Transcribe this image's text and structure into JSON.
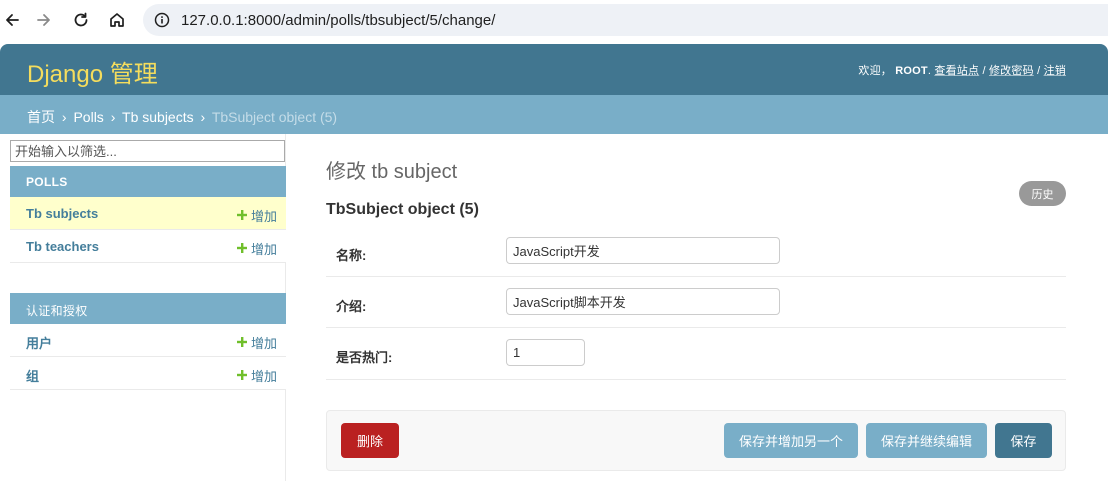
{
  "browser": {
    "url": "127.0.0.1:8000/admin/polls/tbsubject/5/change/"
  },
  "header": {
    "brand": "Django 管理",
    "welcome": "欢迎，",
    "username": "ROOT",
    "view_site": "查看站点",
    "separator": "/",
    "change_password": "修改密码",
    "logout": "注销"
  },
  "breadcrumbs": {
    "home": "首页",
    "app": "Polls",
    "model": "Tb subjects",
    "current": "TbSubject object (5)",
    "sep": "›"
  },
  "sidebar": {
    "filter_placeholder": "开始输入以筛选...",
    "modules": [
      {
        "caption": "POLLS",
        "models": [
          {
            "name": "Tb subjects",
            "add_label": "增加",
            "current": true
          },
          {
            "name": "Tb teachers",
            "add_label": "增加",
            "current": false
          }
        ]
      },
      {
        "caption": "认证和授权",
        "models": [
          {
            "name": "用户",
            "add_label": "增加",
            "current": false
          },
          {
            "name": "组",
            "add_label": "增加",
            "current": false
          }
        ]
      }
    ]
  },
  "content": {
    "title": "修改 tb subject",
    "history_label": "历史",
    "object_title": "TbSubject object (5)",
    "fields": [
      {
        "label": "名称:",
        "value": "JavaScript开发"
      },
      {
        "label": "介绍:",
        "value": "JavaScript脚本开发"
      },
      {
        "label": "是否热门:",
        "value": "1"
      }
    ]
  },
  "submit_row": {
    "delete_label": "删除",
    "save_add_label": "保存并增加另一个",
    "save_continue_label": "保存并继续编辑",
    "save_label": "保存"
  },
  "colors": {
    "header_bg": "#417690",
    "brand": "#f5dd5d",
    "breadcrumbs_bg": "#79aec8",
    "current_row_bg": "#ffffcc",
    "delete_bg": "#ba2121",
    "add_icon": "#70bf2b"
  }
}
